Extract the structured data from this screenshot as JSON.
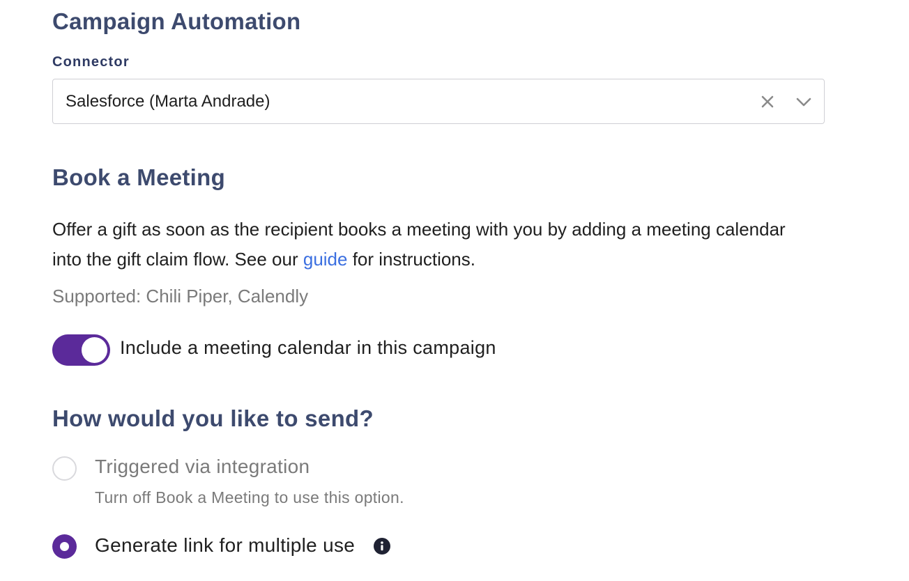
{
  "campaign_automation": {
    "title": "Campaign Automation",
    "connector_label": "Connector",
    "connector_value": "Salesforce (Marta Andrade)",
    "clear_icon": "close-icon",
    "dropdown_icon": "chevron-down-icon"
  },
  "book_meeting": {
    "title": "Book a Meeting",
    "description_before": "Offer a gift as soon as the recipient books a meeting with you by adding a meeting calendar into the gift claim flow. See our ",
    "guide_link": "guide",
    "description_after": " for instructions.",
    "supported": "Supported: Chili Piper, Calendly",
    "toggle_on": true,
    "toggle_label": "Include a meeting calendar in this campaign"
  },
  "send_method": {
    "title": "How would you like to send?",
    "options": [
      {
        "label": "Triggered via integration",
        "hint": "Turn off Book a Meeting to use this option.",
        "selected": false,
        "disabled": true
      },
      {
        "label": "Generate link for multiple use",
        "selected": true,
        "disabled": false,
        "info_icon": "info-icon"
      }
    ]
  },
  "colors": {
    "heading": "#3d4a6e",
    "label": "#2e3a63",
    "accent": "#5b2a9a",
    "link": "#3b6fe0",
    "muted": "#7a7a7a",
    "border": "#cfcfd4"
  }
}
